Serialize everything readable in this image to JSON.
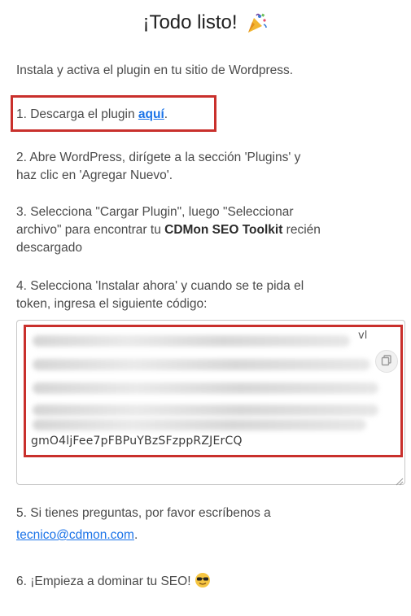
{
  "header": {
    "title": "¡Todo listo!",
    "icon": "party-popper-icon"
  },
  "intro": "Instala y activa el plugin en tu sitio de Wordpress.",
  "steps": {
    "s1_prefix": "1. Descarga el plugin ",
    "s1_link": "aquí",
    "s1_suffix": ".",
    "s2_line1": "2. Abre WordPress, dirígete a la sección 'Plugins' y",
    "s2_line2": "haz clic en 'Agregar Nuevo'.",
    "s3_line1": "3. Selecciona \"Cargar Plugin\", luego \"Seleccionar",
    "s3_line2_prefix": "archivo\" para encontrar tu ",
    "s3_bold": "CDMon SEO Toolkit",
    "s3_line2_suffix": " recién",
    "s3_line3": "descargado",
    "s4_line1": "4. Selecciona 'Instalar ahora' y cuando se te pida el",
    "s4_line2": "token, ingresa el siguiente código:",
    "s5_line1": "5. Si tienes preguntas, por favor escríbenos a",
    "s5_email": "tecnico@cdmon.com",
    "s5_suffix": ".",
    "s6_text": "6. ¡Empieza a dominar tu SEO! ",
    "s6_icon": "sunglasses-face-icon"
  },
  "token": {
    "visible_tail": "gmO4ljFee7pFBPuYBzSFzppRZJErCQ",
    "fragment": "vl",
    "copy_icon": "copy-icon"
  },
  "colors": {
    "highlight": "#c9302c",
    "link": "#1a73e8"
  }
}
